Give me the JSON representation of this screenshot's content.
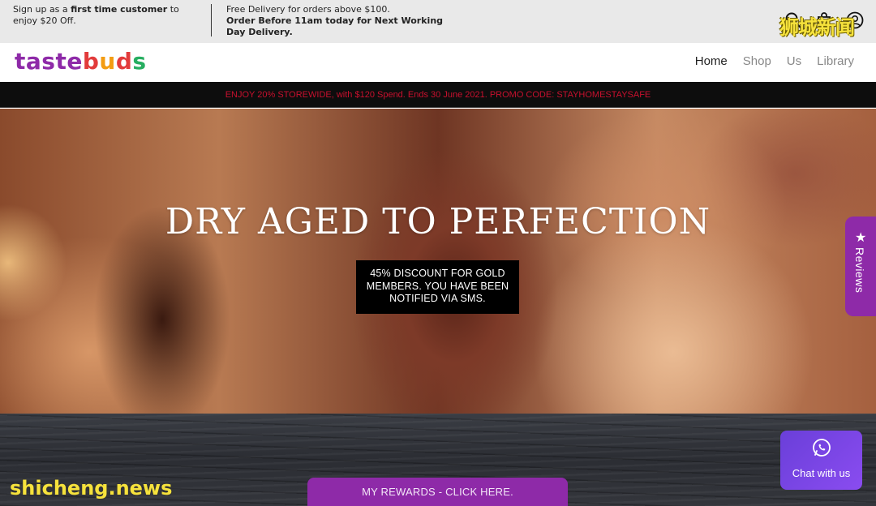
{
  "topbar": {
    "signup_pre": "Sign up as a ",
    "signup_bold": "first time customer",
    "signup_post": " to enjoy $20 Off.",
    "delivery_line1": "Free Delivery for orders above $100.",
    "delivery_bold": "Order Before 11am today for Next Working Day Delivery.",
    "icons": [
      "search-icon",
      "cart-icon",
      "account-icon"
    ]
  },
  "header": {
    "logo_letters": [
      {
        "ch": "t",
        "color": "#8e2aa8"
      },
      {
        "ch": "a",
        "color": "#8e2aa8"
      },
      {
        "ch": "s",
        "color": "#8e2aa8"
      },
      {
        "ch": "t",
        "color": "#8e2aa8"
      },
      {
        "ch": "e",
        "color": "#8e2aa8"
      },
      {
        "ch": "b",
        "color": "#e23b3b"
      },
      {
        "ch": "u",
        "color": "#f39c12"
      },
      {
        "ch": "d",
        "color": "#e23b3b"
      },
      {
        "ch": "s",
        "color": "#27ae60"
      }
    ],
    "nav": [
      {
        "label": "Home",
        "active": true
      },
      {
        "label": "Shop",
        "active": false
      },
      {
        "label": "Us",
        "active": false
      },
      {
        "label": "Library",
        "active": false
      }
    ]
  },
  "announcement": "ENJOY 20% STOREWIDE, with $120 Spend. Ends 30 June 2021. PROMO CODE: STAYHOMESTAYSAFE",
  "hero": {
    "title": "DRY AGED TO PERFECTION",
    "badge": "45% DISCOUNT FOR GOLD MEMBERS. YOU HAVE BEEN NOTIFIED VIA SMS."
  },
  "rewards_button": "MY REWARDS - CLICK HERE.",
  "reviews_tab": "Reviews",
  "chat": {
    "label": "Chat with us",
    "icon": "whatsapp-icon"
  },
  "watermarks": {
    "top": "狮城新闻",
    "bottom": "shicheng.news"
  },
  "colors": {
    "brand_purple": "#8e2aa8",
    "announce_red": "#c8102e",
    "chat_purple": "#7a45e6"
  }
}
